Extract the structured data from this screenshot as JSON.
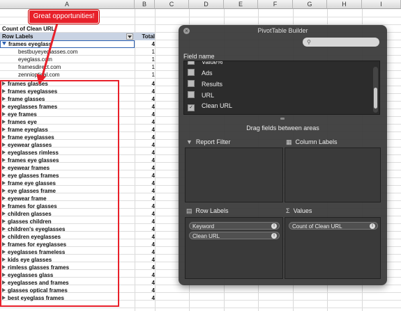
{
  "columns": [
    "A",
    "B",
    "C",
    "D",
    "E",
    "F",
    "G",
    "H",
    "I"
  ],
  "callout": "Great opportunities!",
  "pivot": {
    "header": "Count of Clean URL",
    "row_labels": "Row Labels",
    "total_label": "Total",
    "expanded": {
      "label": "frames eyeglass",
      "value": "4"
    },
    "children": [
      {
        "label": "bestbuyeyeglasses.com",
        "value": "1"
      },
      {
        "label": "eyeglass.com",
        "value": "1"
      },
      {
        "label": "framesdirect.com",
        "value": "1"
      },
      {
        "label": "zennioptical.com",
        "value": "1"
      }
    ],
    "rows": [
      {
        "label": "frames glasses",
        "value": "4"
      },
      {
        "label": "frames eyeglasses",
        "value": "4"
      },
      {
        "label": "frame glasses",
        "value": "4"
      },
      {
        "label": "eyeglasses frames",
        "value": "4"
      },
      {
        "label": "eye frames",
        "value": "4"
      },
      {
        "label": "frames eye",
        "value": "4"
      },
      {
        "label": "frame eyeglass",
        "value": "4"
      },
      {
        "label": "frame eyeglasses",
        "value": "4"
      },
      {
        "label": "eyewear glasses",
        "value": "4"
      },
      {
        "label": "eyeglasses rimless",
        "value": "4"
      },
      {
        "label": "frames eye glasses",
        "value": "4"
      },
      {
        "label": "eyewear frames",
        "value": "4"
      },
      {
        "label": "eye glasses frames",
        "value": "4"
      },
      {
        "label": "frame eye glasses",
        "value": "4"
      },
      {
        "label": "eye glasses frame",
        "value": "4"
      },
      {
        "label": "eyewear frame",
        "value": "4"
      },
      {
        "label": "frames for glasses",
        "value": "4"
      },
      {
        "label": "children glasses",
        "value": "4"
      },
      {
        "label": "glasses children",
        "value": "4"
      },
      {
        "label": "children's eyeglasses",
        "value": "4"
      },
      {
        "label": "children eyeglasses",
        "value": "4"
      },
      {
        "label": "frames for eyeglasses",
        "value": "4"
      },
      {
        "label": "eyeglasses frameless",
        "value": "4"
      },
      {
        "label": "kids eye glasses",
        "value": "4"
      },
      {
        "label": "rimless glasses frames",
        "value": "4"
      },
      {
        "label": "eyeglasses glass",
        "value": "4"
      },
      {
        "label": "eyeglasses and frames",
        "value": "4"
      },
      {
        "label": "glasses optical frames",
        "value": "4"
      },
      {
        "label": "best eyeglass frames",
        "value": "4"
      }
    ]
  },
  "builder": {
    "title": "PivotTable Builder",
    "field_name_label": "Field name",
    "fields": [
      {
        "label": "Value%",
        "checked": false
      },
      {
        "label": "Ads",
        "checked": false
      },
      {
        "label": "Results",
        "checked": false
      },
      {
        "label": "URL",
        "checked": false
      },
      {
        "label": "Clean URL",
        "checked": true
      }
    ],
    "drag_hint": "Drag fields between areas",
    "report_filter": "Report Filter",
    "column_labels": "Column Labels",
    "row_labels": "Row Labels",
    "values": "Values",
    "row_pills": [
      "Keyword",
      "Clean URL"
    ],
    "value_pills": [
      "Count of Clean URL"
    ]
  }
}
